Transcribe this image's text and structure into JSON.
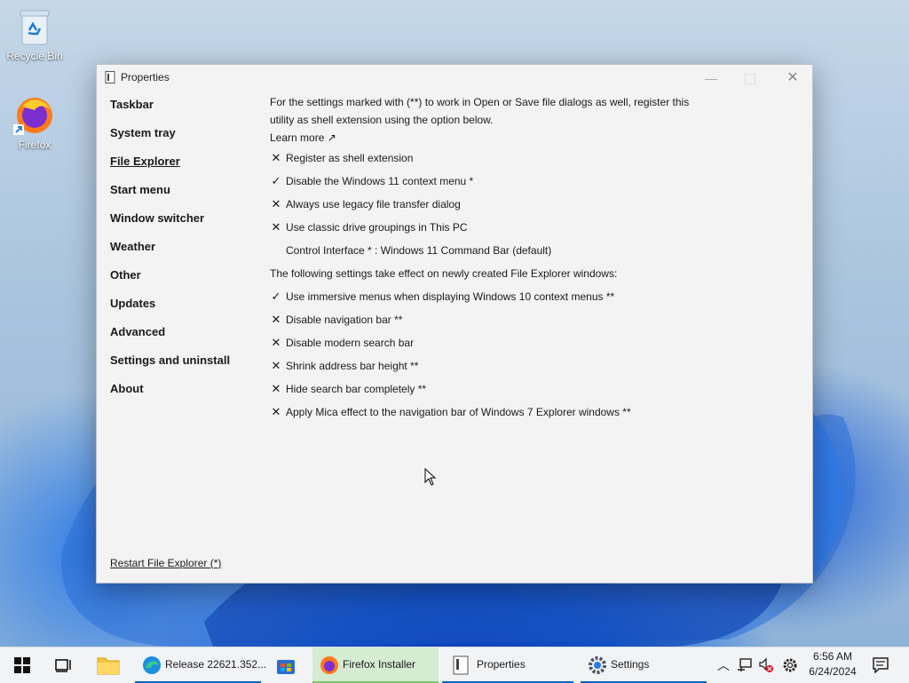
{
  "desktop": {
    "icons": [
      {
        "label": "Recycle Bin"
      },
      {
        "label": "Firefox"
      }
    ]
  },
  "window": {
    "title": "Properties",
    "nav": [
      {
        "label": "Taskbar",
        "active": false
      },
      {
        "label": "System tray",
        "active": false
      },
      {
        "label": "File Explorer",
        "active": true
      },
      {
        "label": "Start menu",
        "active": false
      },
      {
        "label": "Window switcher",
        "active": false
      },
      {
        "label": "Weather",
        "active": false
      },
      {
        "label": "Other",
        "active": false
      },
      {
        "label": "Updates",
        "active": false
      },
      {
        "label": "Advanced",
        "active": false
      },
      {
        "label": "Settings and uninstall",
        "active": false
      },
      {
        "label": "About",
        "active": false
      }
    ],
    "intro": "For the settings marked with (**) to work in Open or Save file dialogs as well, register this utility as shell extension using the option below.",
    "learn_more": "Learn more ↗",
    "options_top": [
      {
        "mark": "✕",
        "label": "Register as shell extension"
      },
      {
        "mark": "✓",
        "label": "Disable the Windows 11 context menu *"
      },
      {
        "mark": "✕",
        "label": "Always use legacy file transfer dialog"
      },
      {
        "mark": "✕",
        "label": "Use classic drive groupings in This PC"
      }
    ],
    "control_interface": "Control Interface * : Windows 11 Command Bar (default)",
    "section_label": "The following settings take effect on newly created File Explorer windows:",
    "options_bottom": [
      {
        "mark": "✓",
        "label": "Use immersive menus when displaying Windows 10 context menus **"
      },
      {
        "mark": "✕",
        "label": "Disable navigation bar **"
      },
      {
        "mark": "✕",
        "label": "Disable modern search bar"
      },
      {
        "mark": "✕",
        "label": "Shrink address bar height **"
      },
      {
        "mark": "✕",
        "label": "Hide search bar completely **"
      },
      {
        "mark": "✕",
        "label": "Apply Mica effect to the navigation bar of Windows 7 Explorer windows **"
      }
    ],
    "restart_link": "Restart File Explorer (*)"
  },
  "taskbar": {
    "apps": [
      {
        "label": "Release 22621.352...",
        "icon": "edge-icon"
      },
      {
        "label": "Firefox Installer",
        "icon": "firefox-icon"
      },
      {
        "label": "Properties",
        "icon": "properties-icon"
      },
      {
        "label": "Settings",
        "icon": "settings-gear-icon"
      }
    ],
    "time": "6:56 AM",
    "date": "6/24/2024"
  },
  "colors": {
    "accent": "#0067c0",
    "firefox_highlight": "#d5ebd2"
  }
}
